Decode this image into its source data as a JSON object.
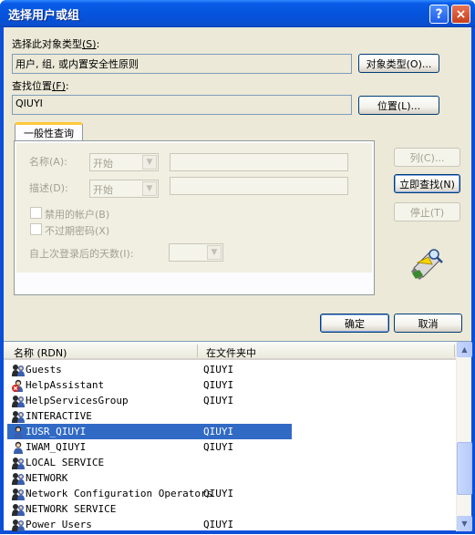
{
  "window": {
    "title": "选择用户或组"
  },
  "title_buttons": {
    "help": "?",
    "close": "×"
  },
  "object_types": {
    "label": "选择此对象类型",
    "accel": "(S)",
    "accel_colon": ":",
    "value": "用户, 组, 或内置安全性原则",
    "button": "对象类型(O)..."
  },
  "location": {
    "label": "查找位置",
    "accel": "(F)",
    "accel_colon": ":",
    "value": "QIUYI",
    "button": "位置(L)..."
  },
  "tab": {
    "label": "一般性查询"
  },
  "query": {
    "name_label": "名称(A):",
    "name_op": "开始",
    "desc_label": "描述(D):",
    "desc_op": "开始",
    "disabled_accounts": "禁用的帐户(B)",
    "no_expire_pwd": "不过期密码(X)",
    "days_since_logon": "自上次登录后的天数(I):"
  },
  "side_buttons": {
    "columns": "列(C)...",
    "find_now": "立即查找(N)",
    "stop": "停止(T)"
  },
  "dialog_buttons": {
    "ok": "确定",
    "cancel": "取消"
  },
  "results": {
    "columns": [
      "名称 (RDN)",
      "在文件夹中"
    ],
    "rows": [
      {
        "name": "Guests",
        "folder": "QIUYI",
        "icon": "group-icon",
        "selected": false
      },
      {
        "name": "HelpAssistant",
        "folder": "QIUYI",
        "icon": "disabled-user-icon",
        "selected": false
      },
      {
        "name": "HelpServicesGroup",
        "folder": "QIUYI",
        "icon": "group-icon",
        "selected": false
      },
      {
        "name": "INTERACTIVE",
        "folder": "",
        "icon": "group-icon",
        "selected": false
      },
      {
        "name": "IUSR_QIUYI",
        "folder": "QIUYI",
        "icon": "user-icon",
        "selected": true
      },
      {
        "name": "IWAM_QIUYI",
        "folder": "QIUYI",
        "icon": "user-icon",
        "selected": false
      },
      {
        "name": "LOCAL SERVICE",
        "folder": "",
        "icon": "group-icon",
        "selected": false
      },
      {
        "name": "NETWORK",
        "folder": "",
        "icon": "group-icon",
        "selected": false
      },
      {
        "name": "Network Configuration Operators",
        "folder": "QIUYI",
        "icon": "group-icon",
        "selected": false
      },
      {
        "name": "NETWORK SERVICE",
        "folder": "",
        "icon": "group-icon",
        "selected": false
      },
      {
        "name": "Power Users",
        "folder": "QIUYI",
        "icon": "group-icon",
        "selected": false
      }
    ]
  },
  "colors": {
    "titlebar": "#0553dc",
    "selection": "#316ac5",
    "dialog_bg": "#ece9d8"
  }
}
